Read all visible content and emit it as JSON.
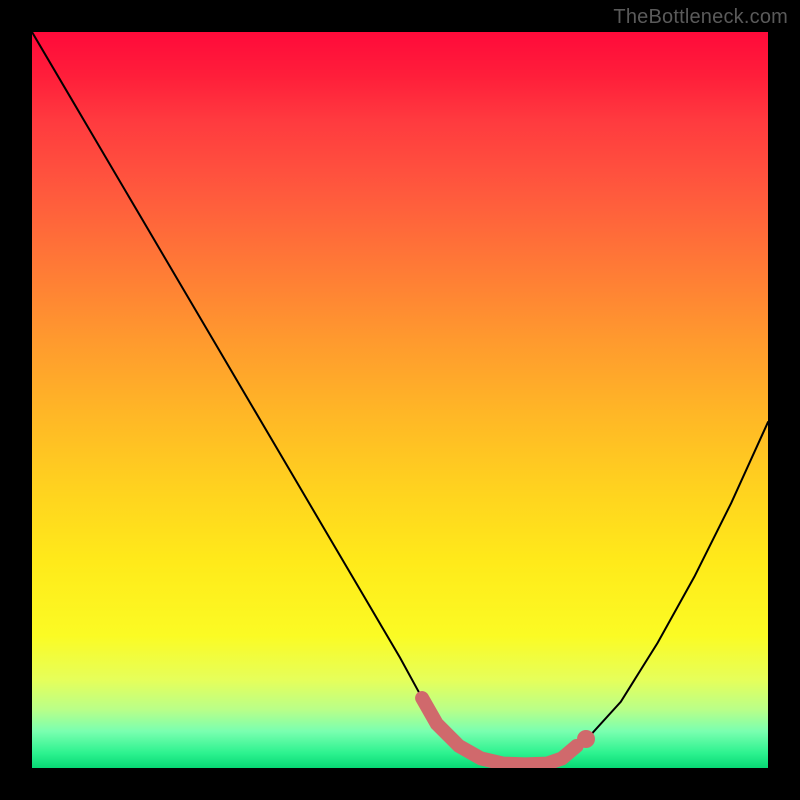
{
  "watermark": {
    "text": "TheBottleneck.com"
  },
  "chart_data": {
    "type": "line",
    "title": "",
    "xlabel": "",
    "ylabel": "",
    "xlim": [
      0,
      100
    ],
    "ylim": [
      0,
      100
    ],
    "grid": false,
    "legend": false,
    "series": [
      {
        "name": "bottleneck-curve",
        "x": [
          0,
          5,
          10,
          15,
          20,
          25,
          30,
          35,
          40,
          45,
          50,
          53,
          55,
          58,
          61,
          64,
          67,
          70,
          72,
          75,
          80,
          85,
          90,
          95,
          100
        ],
        "y": [
          100,
          91.5,
          83,
          74.5,
          66,
          57.5,
          49,
          40.5,
          32,
          23.5,
          15,
          9.5,
          6,
          3,
          1.3,
          0.6,
          0.5,
          0.6,
          1.3,
          3.5,
          9,
          17,
          26,
          36,
          47
        ]
      }
    ],
    "markers": [
      {
        "name": "highlight-region",
        "x_start": 53,
        "x_end": 74,
        "color": "#d0696c"
      }
    ],
    "background_gradient": {
      "stops": [
        {
          "pos": 0.0,
          "color": "#ff0a3a"
        },
        {
          "pos": 0.5,
          "color": "#ffb726"
        },
        {
          "pos": 0.82,
          "color": "#fbfb24"
        },
        {
          "pos": 1.0,
          "color": "#07d874"
        }
      ]
    }
  }
}
